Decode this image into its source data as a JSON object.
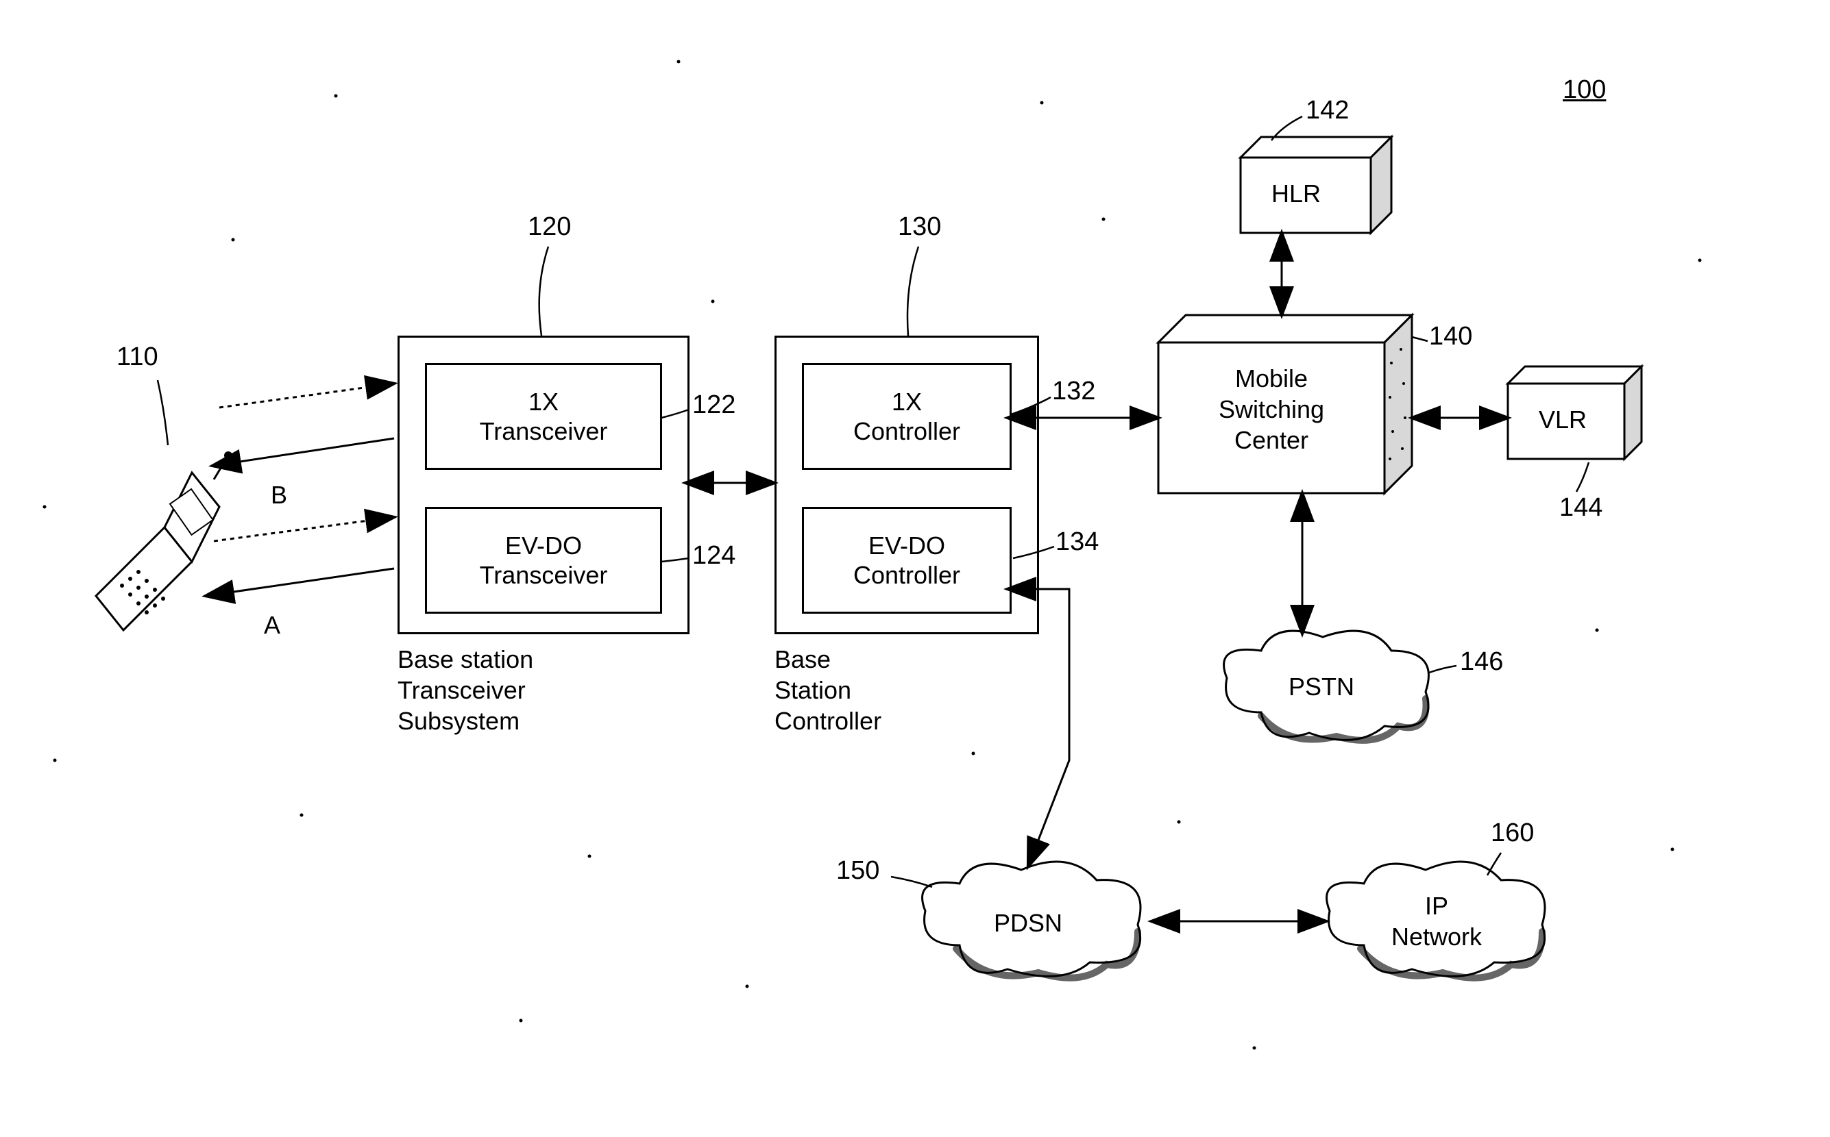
{
  "figure_ref": "100",
  "nodes": {
    "mobile": {
      "ref": "110"
    },
    "bts": {
      "ref": "120",
      "caption": "Base station\nTransceiver\nSubsystem",
      "tx1x": {
        "label": "1X\nTransceiver",
        "ref": "122"
      },
      "evdo": {
        "label": "EV-DO\nTransceiver",
        "ref": "124"
      }
    },
    "bsc": {
      "ref": "130",
      "caption": "Base\nStation\nController",
      "ctrl1x": {
        "label": "1X\nController",
        "ref": "132"
      },
      "evdo": {
        "label": "EV-DO\nController",
        "ref": "134"
      }
    },
    "msc": {
      "label": "Mobile\nSwitching\nCenter",
      "ref": "140"
    },
    "hlr": {
      "label": "HLR",
      "ref": "142"
    },
    "vlr": {
      "label": "VLR",
      "ref": "144"
    },
    "pstn": {
      "label": "PSTN",
      "ref": "146"
    },
    "pdsn": {
      "label": "PDSN",
      "ref": "150"
    },
    "ip": {
      "label": "IP\nNetwork",
      "ref": "160"
    }
  },
  "link_labels": {
    "A": "A",
    "B": "B"
  }
}
